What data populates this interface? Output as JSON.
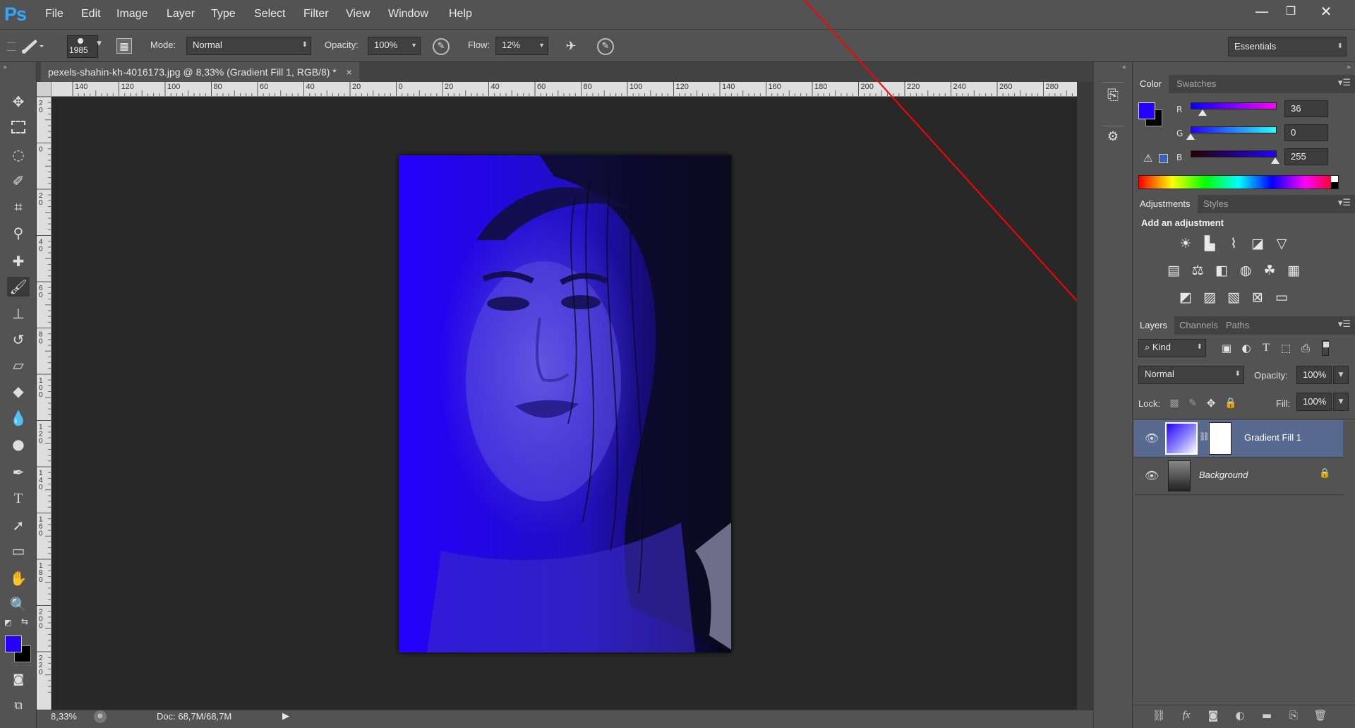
{
  "app": {
    "logo": "Ps",
    "menu": [
      "File",
      "Edit",
      "Image",
      "Layer",
      "Type",
      "Select",
      "Filter",
      "View",
      "Window",
      "Help"
    ],
    "window_controls": [
      "minimize",
      "restore",
      "close"
    ]
  },
  "options_bar": {
    "brush_size": "1985",
    "mode_label": "Mode:",
    "mode_value": "Normal",
    "opacity_label": "Opacity:",
    "opacity_value": "100%",
    "flow_label": "Flow:",
    "flow_value": "12%",
    "workspace": "Essentials"
  },
  "document": {
    "tab_title": "pexels-shahin-kh-4016173.jpg @ 8,33% (Gradient Fill 1, RGB/8) *",
    "close_glyph": "×"
  },
  "ruler": {
    "horizontal": [
      "140",
      "120",
      "100",
      "80",
      "60",
      "40",
      "20",
      "0",
      "20",
      "40",
      "60",
      "80",
      "100",
      "120",
      "140",
      "160",
      "180",
      "200",
      "220",
      "240",
      "260",
      "280"
    ],
    "vertical": [
      "20",
      "0",
      "20",
      "40",
      "60",
      "80",
      "100",
      "120",
      "140",
      "160",
      "180",
      "200",
      "220"
    ]
  },
  "status_bar": {
    "zoom": "8,33%",
    "doc_info": "Doc: 68,7M/68,7M"
  },
  "colors": {
    "foreground": "#2400ff",
    "background": "#000000",
    "accent": "#31a8ff",
    "annotation_arrow": "#ff0000"
  },
  "color_panel": {
    "tabs": [
      "Color",
      "Swatches"
    ],
    "channels": [
      {
        "name": "R",
        "value": "36",
        "level": 0.14
      },
      {
        "name": "G",
        "value": "0",
        "level": 0.0
      },
      {
        "name": "B",
        "value": "255",
        "level": 1.0
      }
    ]
  },
  "adjustments_panel": {
    "tabs": [
      "Adjustments",
      "Styles"
    ],
    "heading": "Add an adjustment",
    "icons_row1": [
      "brightness-icon",
      "levels-icon",
      "curves-icon",
      "exposure-icon",
      "vibrance-icon"
    ],
    "icons_row2": [
      "hue-saturation-icon",
      "color-balance-icon",
      "black-white-icon",
      "photo-filter-icon",
      "channel-mixer-icon",
      "color-lookup-icon"
    ],
    "icons_row3": [
      "invert-icon",
      "posterize-icon",
      "threshold-icon",
      "selective-color-icon",
      "gradient-map-icon"
    ]
  },
  "layers_panel": {
    "tabs": [
      "Layers",
      "Channels",
      "Paths"
    ],
    "filter_kind": "Kind",
    "blend_mode": "Normal",
    "opacity_label": "Opacity:",
    "opacity_value": "100%",
    "lock_label": "Lock:",
    "fill_label": "Fill:",
    "fill_value": "100%",
    "layers": [
      {
        "name": "Gradient Fill 1",
        "selected": true,
        "locked": false
      },
      {
        "name": "Background",
        "selected": false,
        "locked": true
      }
    ]
  }
}
